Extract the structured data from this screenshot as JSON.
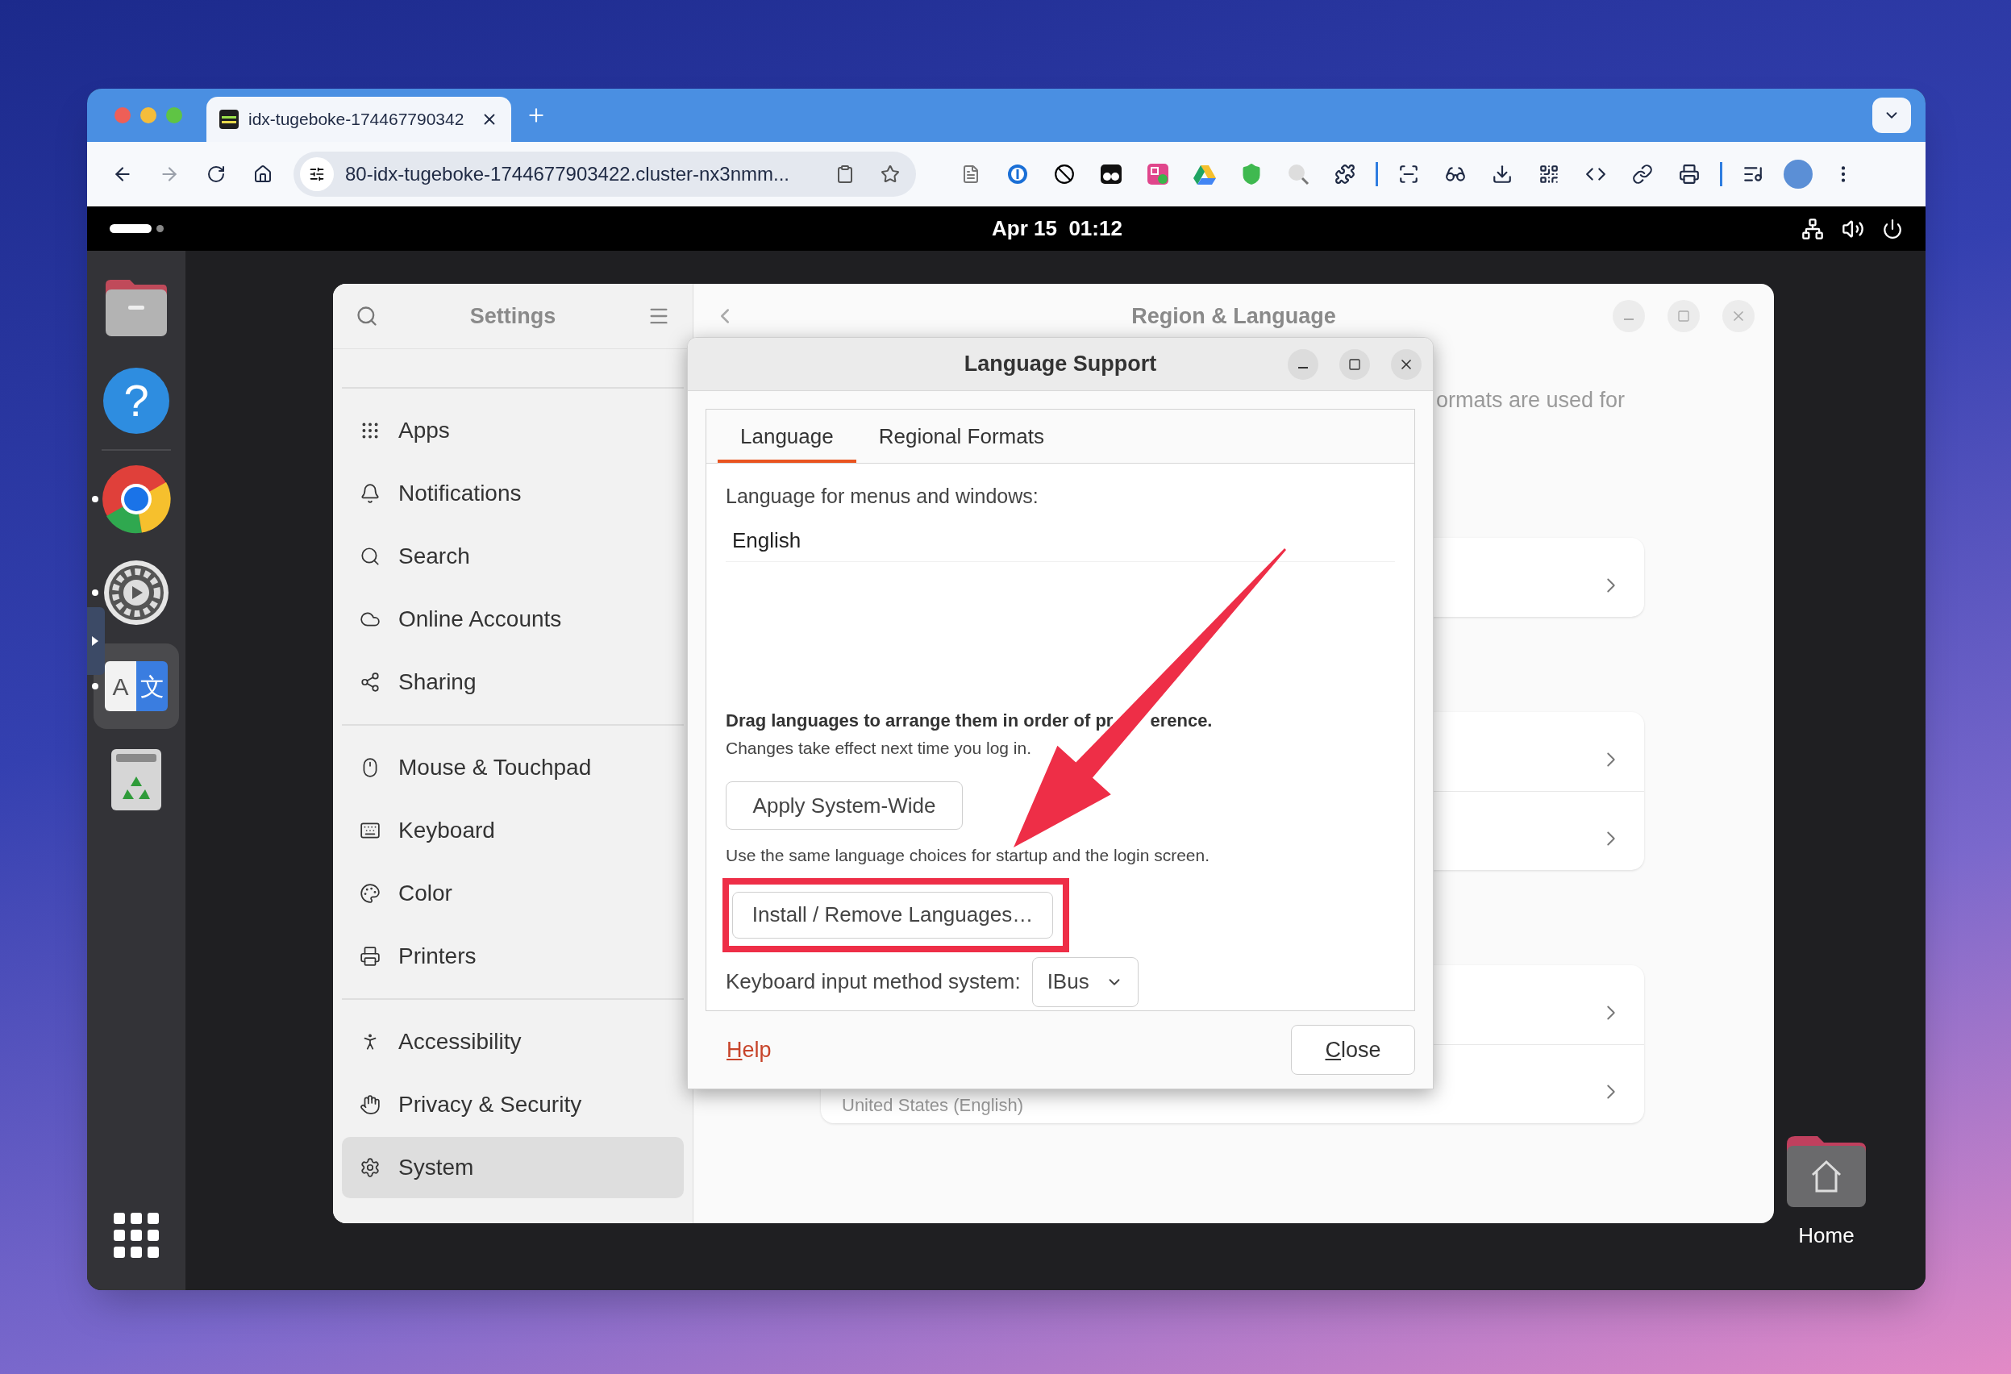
{
  "browser": {
    "tabs": [
      {
        "title": "idx-tugeboke-174467790342",
        "selected": true
      }
    ],
    "address": "80-idx-tugeboke-1744677903422.cluster-nx3nmm..."
  },
  "top_bar": {
    "date": "Apr 15",
    "time": "01:12"
  },
  "dock": {
    "favorites": [
      {
        "kind": "files",
        "running": false,
        "selected": false
      },
      {
        "kind": "help",
        "glyphs": [
          "?"
        ],
        "running": false,
        "selected": false
      }
    ],
    "apps": [
      {
        "kind": "chrome",
        "running": true,
        "selected": false
      },
      {
        "kind": "settings",
        "running": true,
        "selected": false
      },
      {
        "kind": "language",
        "glyphs": [
          "A",
          "文"
        ],
        "running": true,
        "selected": true
      },
      {
        "kind": "trash",
        "running": false,
        "selected": false
      }
    ]
  },
  "settings": {
    "title": "Settings",
    "sidebar": {
      "groups": [
        [
          {
            "label": "Apps",
            "selected": false
          },
          {
            "label": "Notifications",
            "selected": false
          },
          {
            "label": "Search",
            "selected": false
          },
          {
            "label": "Online Accounts",
            "selected": false
          },
          {
            "label": "Sharing",
            "selected": false
          }
        ],
        [
          {
            "label": "Mouse & Touchpad",
            "selected": false
          },
          {
            "label": "Keyboard",
            "selected": false
          },
          {
            "label": "Color",
            "selected": false
          },
          {
            "label": "Printers",
            "selected": false
          }
        ],
        [
          {
            "label": "Accessibility",
            "selected": false
          },
          {
            "label": "Privacy & Security",
            "selected": false
          },
          {
            "label": "System",
            "selected": true
          }
        ]
      ]
    },
    "pane": {
      "title": "Region & Language",
      "description": "ormats are used for",
      "cards": [
        [
          {
            "kind": "link"
          }
        ],
        [
          {
            "kind": "link"
          },
          {
            "kind": "link"
          }
        ],
        [
          {
            "kind": "link"
          },
          {
            "kind": "link",
            "value": "United States (English)"
          }
        ]
      ]
    }
  },
  "dialog": {
    "title": "Language Support",
    "tabs": [
      {
        "label": "Language",
        "selected": true
      },
      {
        "label": "Regional Formats",
        "selected": false
      }
    ],
    "language_label": "Language for menus and windows:",
    "languages": [
      "English"
    ],
    "drag_hint": [
      "Drag languages to arrange them in order of pr",
      "erence."
    ],
    "restart_hint": "Changes take effect next time you log in.",
    "apply_button": "Apply System-Wide",
    "apply_hint": "Use the same language choices for startup and the login screen.",
    "install_button": {
      "label": "Install / Remove Languages…",
      "highlighted": true
    },
    "input_method_label": "Keyboard input method system:",
    "input_method": "IBus",
    "help_button": "Help",
    "close_button": "Close"
  },
  "desktop_icons": [
    {
      "kind": "home",
      "label": "Home"
    }
  ]
}
